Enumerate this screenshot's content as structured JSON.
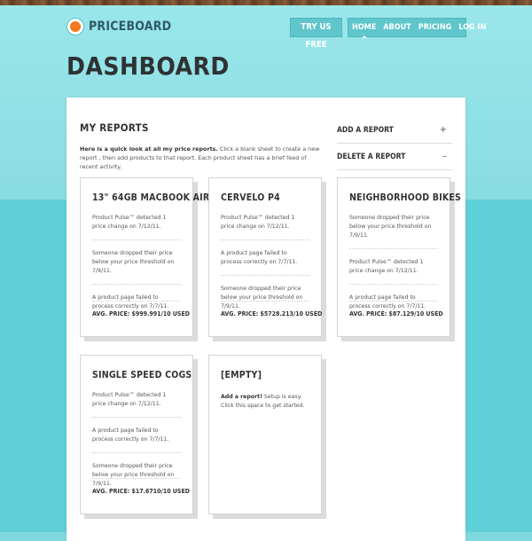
{
  "brand": {
    "name": "PRICEBOARD",
    "logo_color": "#f47a20"
  },
  "header": {
    "try_label": "TRY US FREE",
    "nav": [
      {
        "label": "HOME"
      },
      {
        "label": "ABOUT"
      },
      {
        "label": "PRICING"
      },
      {
        "label": "LOG IN"
      }
    ]
  },
  "page": {
    "title": "DASHBOARD"
  },
  "reports": {
    "heading": "MY REPORTS",
    "intro_bold": "Here is a quick look at all my price reports.",
    "intro_rest": " Click a blank sheet to create a new report , then add products to that report. Each product sheet has a brief feed of recent activity."
  },
  "actions": {
    "add": {
      "label": "ADD A REPORT",
      "icon": "+"
    },
    "delete": {
      "label": "DELETE A REPORT",
      "icon": "–"
    }
  },
  "cards": [
    {
      "title": "13\" 64GB MACBOOK AIR",
      "feed": [
        "Product Pulse™ detected 1 price change on 7/12/11.",
        "Someone dropped their price below your price threshold on 7/9/11.",
        "A product page failed to process correctly on 7/7/11."
      ],
      "avg": "AVG. PRICE: $999.99",
      "used": "1/10 USED"
    },
    {
      "title": "CERVELO P4",
      "feed": [
        "Product Pulse™ detected 1 price change on 7/12/11.",
        "A product page failed to process correctly on 7/7/11.",
        "Someone dropped their price below your price threshold on 7/9/11."
      ],
      "avg": "AVG. PRICE: $5728.21",
      "used": "3/10 USED"
    },
    {
      "title": "NEIGHBORHOOD BIKES",
      "feed": [
        "Someone dropped their price below your price threshold on 7/9/11.",
        "Product Pulse™ detected 1 price change on 7/12/11.",
        "A product page failed to process correctly on 7/7/11."
      ],
      "avg": "AVG. PRICE: $87.12",
      "used": "9/10 USED"
    },
    {
      "title": "SINGLE SPEED COGS",
      "feed": [
        "Product Pulse™ detected 1 price change on 7/12/11.",
        "A product page failed to process correctly on 7/7/11.",
        "Someone dropped their price below your price threshold on 7/9/11."
      ],
      "avg": "AVG. PRICE: $17.67",
      "used": "10/10 USED"
    }
  ],
  "empty_card": {
    "title": "[EMPTY]",
    "body_bold": "Add a report!",
    "body_rest": " Setup is easy. Click this space to get started."
  }
}
